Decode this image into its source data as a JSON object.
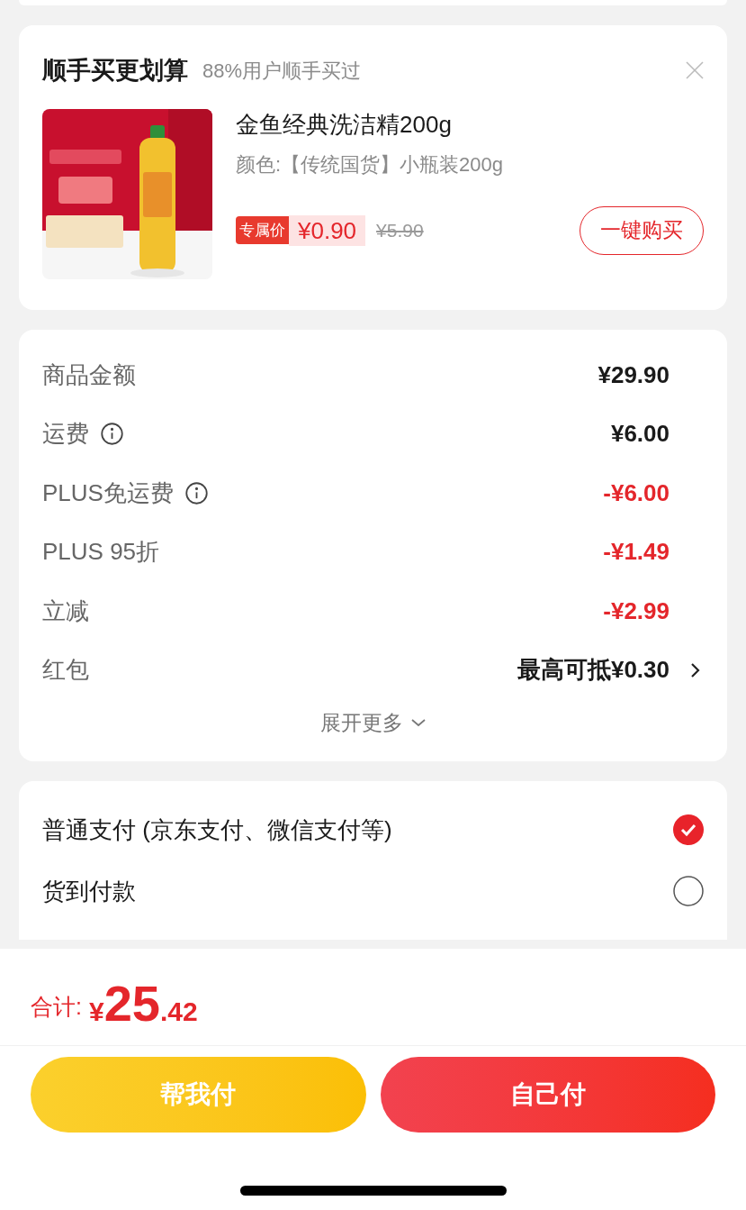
{
  "upsell": {
    "title": "顺手买更划算",
    "subtitle": "88%用户顺手买过",
    "product": {
      "name": "金鱼经典洗洁精200g",
      "variant": "颜色:【传统国货】小瓶装200g",
      "price_tag": "专属价",
      "price": "¥0.90",
      "original_price": "¥5.90",
      "buy_button": "一键购买"
    }
  },
  "fees": [
    {
      "label": "商品金额",
      "value": "¥29.90",
      "kind": "normal",
      "info": false
    },
    {
      "label": "运费",
      "value": "¥6.00",
      "kind": "normal",
      "info": true
    },
    {
      "label": "PLUS免运费",
      "value": "-¥6.00",
      "kind": "discount",
      "info": true
    },
    {
      "label": "PLUS 95折",
      "value": "-¥1.49",
      "kind": "discount",
      "info": false
    },
    {
      "label": "立减",
      "value": "-¥2.99",
      "kind": "discount",
      "info": false
    },
    {
      "label": "红包",
      "value": "最高可抵¥0.30",
      "kind": "link",
      "info": false
    }
  ],
  "expand_more": "展开更多",
  "payment_options": [
    {
      "label": "普通支付 (京东支付、微信支付等)",
      "selected": true
    },
    {
      "label": "货到付款",
      "selected": false
    }
  ],
  "total": {
    "label": "合计:",
    "currency": "¥",
    "integer": "25",
    "decimal": ".42"
  },
  "buttons": [
    {
      "label": "帮我付",
      "kind": "secondary"
    },
    {
      "label": "自己付",
      "kind": "primary"
    }
  ]
}
